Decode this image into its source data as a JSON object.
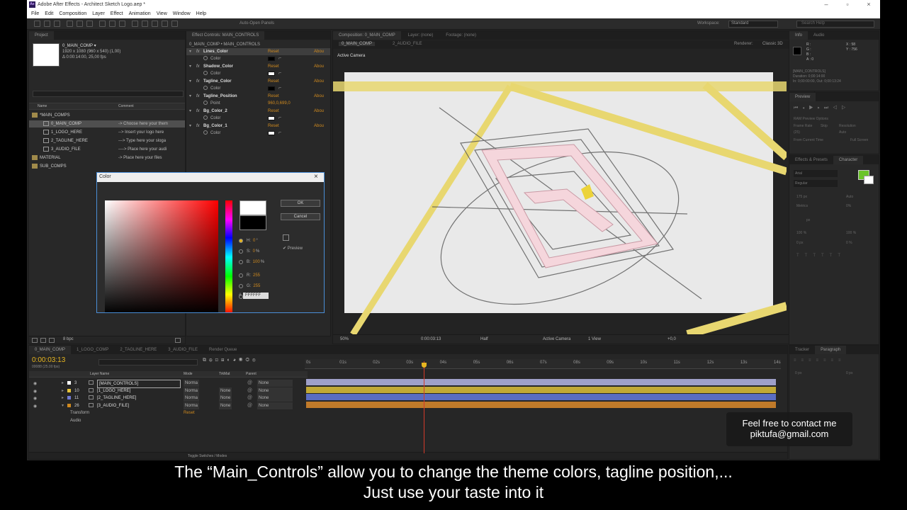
{
  "window": {
    "title": "Adobe After Effects - Architect Sketch Logo.aep *",
    "app_icon": "Ae"
  },
  "menu": [
    "File",
    "Edit",
    "Composition",
    "Layer",
    "Effect",
    "Animation",
    "View",
    "Window",
    "Help"
  ],
  "toolbar": {
    "panels_label": "Auto-Open Panels",
    "workspace_label": "Workspace:",
    "workspace_value": "Standard",
    "search_placeholder": "Search Help"
  },
  "project": {
    "tab": "Project",
    "comp_name": "0_MAIN_COMP ▾",
    "comp_info1": "1920 x 1080  (960 x 540) (1,00)",
    "comp_info2": "Δ 0:00:14:00, 25,00 fps",
    "col_name": "Name",
    "col_comment": "Comment",
    "items": [
      {
        "name": "*MAIN_COMPS",
        "comment": "",
        "type": "folder"
      },
      {
        "name": "0_MAIN_COMP",
        "comment": "-> Choose here your them",
        "type": "comp"
      },
      {
        "name": "1_LOGO_HERE",
        "comment": "--> Insert your logo here",
        "type": "comp"
      },
      {
        "name": "2_TAGLINE_HERE",
        "comment": "---> Type here your sloga",
        "type": "comp"
      },
      {
        "name": "3_AUDIO_FILE",
        "comment": "----> Place here your audi",
        "type": "comp"
      },
      {
        "name": "MATERIAL",
        "comment": "-> Place here your files",
        "type": "folder"
      },
      {
        "name": "SUB_COMPS",
        "comment": "",
        "type": "folder"
      }
    ],
    "bpc": "8 bpc"
  },
  "effect_controls": {
    "tab": "Effect Controls: MAIN_CONTROLS",
    "breadcrumb": "0_MAIN_COMP • MAIN_CONTROLS",
    "reset": "Reset",
    "about": "Abou",
    "effects": [
      {
        "name": "Lines_Color",
        "prop": "Color",
        "value": "",
        "swatch": "#000000"
      },
      {
        "name": "Shadow_Color",
        "prop": "Color",
        "value": "",
        "swatch": "#ffffff"
      },
      {
        "name": "Tagline_Color",
        "prop": "Color",
        "value": "",
        "swatch": "#000000"
      },
      {
        "name": "Tagline_Position",
        "prop": "Point",
        "value": "960,0,699,0",
        "swatch": ""
      },
      {
        "name": "Bg_Color_2",
        "prop": "Color",
        "value": "",
        "swatch": "#ffffff"
      },
      {
        "name": "Bg_Color_1",
        "prop": "Color",
        "value": "",
        "swatch": "#ffffff"
      }
    ]
  },
  "composition": {
    "tab": "Composition: 0_MAIN_COMP",
    "tab2": "Layer: (none)",
    "tab3": "Footage: (none)",
    "subtabs": [
      "0_MAIN_COMP",
      "2_AUDIO_FILE"
    ],
    "renderer": "Renderer:",
    "renderer_value": "Classic 3D",
    "camera_label": "Active Camera",
    "zoom": "50%",
    "timecode": "0:00:03:13",
    "resolution": "Half",
    "view_camera": "Active Camera",
    "views": "1 View",
    "exposure": "+0,0"
  },
  "color_dialog": {
    "title": "Color",
    "ok": "OK",
    "cancel": "Cancel",
    "preview": "Preview",
    "hex": "FFFFFF",
    "fields": [
      {
        "label": "H:",
        "value": "0",
        "unit": "°"
      },
      {
        "label": "S:",
        "value": "0",
        "unit": "%"
      },
      {
        "label": "B:",
        "value": "100",
        "unit": "%"
      },
      {
        "label": "R:",
        "value": "255",
        "unit": ""
      },
      {
        "label": "G:",
        "value": "255",
        "unit": ""
      },
      {
        "label": "B:",
        "value": "255",
        "unit": ""
      }
    ],
    "new_color": "#ffffff",
    "old_color": "#000000"
  },
  "info": {
    "tab": "Info",
    "tab2": "Audio",
    "x": "X : 58",
    "y": "Y : 756",
    "r": "R :",
    "g": "G :",
    "b": "B :",
    "a": "A : 0",
    "line1": "[MAIN_CONTROLS]",
    "line2": "Duration: 0;00:14:00",
    "line3": "In: 0;00:00:00, Out: 0;00:13:24"
  },
  "preview": {
    "tab": "Preview",
    "options": "RAM Preview Options",
    "frame_rate": "Frame Rate",
    "skip": "Skip",
    "resolution": "Resolution",
    "fps": "(25)",
    "auto": "Auto",
    "from_current": "From Current Time",
    "full_screen": "Full Screen"
  },
  "character": {
    "tab": "Effects & Presets",
    "tab2": "Character",
    "font": "Arial",
    "style": "Regular",
    "size": "175 px",
    "metrics": "Metrics",
    "px": "px",
    "scale_v": "100 %",
    "scale_h": "100 %",
    "baseline": "0 px",
    "tsume": "0 %",
    "auto": "Auto",
    "pct": "0%"
  },
  "paragraph": {
    "tab": "Tracker",
    "tab2": "Paragraph",
    "v1": "0 px",
    "v2": "0 px"
  },
  "timeline": {
    "tabs": [
      "0_MAIN_COMP",
      "1_LOGO_COMP",
      "2_TAGLINE_HERE",
      "3_AUDIO_FILE",
      "Render Queue"
    ],
    "timecode": "0:00:03:13",
    "frames": "00088 (25.00 fps)",
    "search_placeholder": "",
    "col_layer": "Layer Name",
    "col_mode": "Mode",
    "col_trkmat": "TrkMat",
    "col_parent": "Parent",
    "ticks": [
      "0s",
      "01s",
      "02s",
      "03s",
      "04s",
      "05s",
      "06s",
      "07s",
      "08s",
      "09s",
      "10s",
      "11s",
      "12s",
      "13s",
      "14s"
    ],
    "layers": [
      {
        "num": "3",
        "name": "[MAIN_CONTROLS]",
        "mode": "Norma",
        "trkmat": "",
        "parent": "None",
        "color": "#9fa0c8",
        "label": "#ffffff"
      },
      {
        "num": "10",
        "name": "[1_LOGO_HERE]",
        "mode": "Norma",
        "trkmat": "None",
        "parent": "None",
        "color": "#c2a935",
        "label": "#e6c33a"
      },
      {
        "num": "11",
        "name": "[2_TAGLINE_HERE]",
        "mode": "Norma",
        "trkmat": "None",
        "parent": "None",
        "color": "#5a6dc2",
        "label": "#6f7ad0"
      },
      {
        "num": "26",
        "name": "[3_AUDIO_FILE]",
        "mode": "Norma",
        "trkmat": "None",
        "parent": "None",
        "color": "#c07a2a",
        "label": "#d08a1e"
      }
    ],
    "sub_transform": "Transform",
    "sub_transform_reset": "Reset",
    "sub_audio": "Audio",
    "toggle_label": "Toggle Switches / Modes"
  },
  "overlay": {
    "subtitle_line1": "The “Main_Controls” allow you to change the theme colors, tagline position,...",
    "subtitle_line2": "Just use your taste into it",
    "contact_line1": "Feel free to contact me",
    "contact_line2": "piktufa@gmail.com"
  }
}
